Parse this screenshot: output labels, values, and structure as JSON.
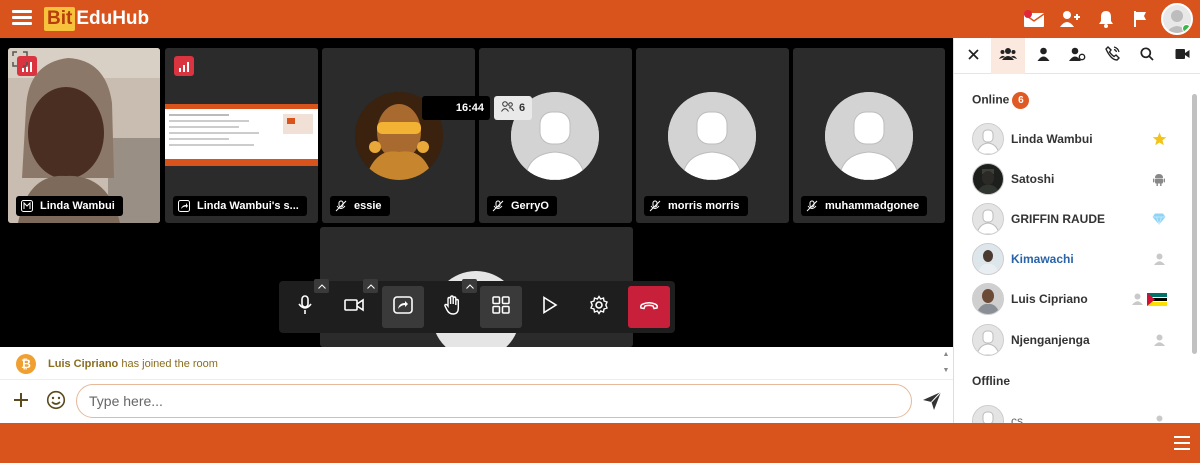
{
  "app": {
    "logo_part1": "Bit",
    "logo_part2": "EduHub"
  },
  "meeting": {
    "timer": "16:44",
    "participant_count": "6"
  },
  "tiles": [
    {
      "name": "Linda Wambui"
    },
    {
      "name": "Linda Wambui's s..."
    },
    {
      "name": "essie"
    },
    {
      "name": "GerryO"
    },
    {
      "name": "morris morris"
    },
    {
      "name": "muhammadgonee"
    }
  ],
  "chat": {
    "coin_symbol": "₿",
    "system_message_user": "Luis Cipriano",
    "system_message_text": " has joined the room",
    "input_placeholder": "Type here...",
    "scroll_up": "▲",
    "scroll_down": "▼"
  },
  "panel": {
    "online_label": "Online",
    "online_count": "6",
    "offline_label": "Offline",
    "online_users": [
      {
        "name": "Linda Wambui"
      },
      {
        "name": "Satoshi"
      },
      {
        "name": "GRIFFIN RAUDE"
      },
      {
        "name": "Kimawachi"
      },
      {
        "name": "Luis Cipriano"
      },
      {
        "name": "Njenganjenga"
      }
    ],
    "offline_users": [
      {
        "name": "cs"
      }
    ]
  },
  "colors": {
    "brand": "#d9531c",
    "hangup": "#c8203a",
    "link": "#2963a8"
  },
  "icons": {
    "topbar": [
      "hamburger-icon",
      "messages-icon",
      "add-user-icon",
      "bell-icon",
      "flag-icon",
      "avatar"
    ],
    "controls": [
      "microphone-icon",
      "camera-icon",
      "screen-share-icon",
      "raise-hand-icon",
      "grid-icon",
      "play-icon",
      "settings-icon",
      "hangup-icon"
    ],
    "panel_tabs": [
      "close-icon",
      "users-icon",
      "user-icon",
      "user-settings-icon",
      "phone-icon",
      "search-icon",
      "video-icon"
    ]
  }
}
